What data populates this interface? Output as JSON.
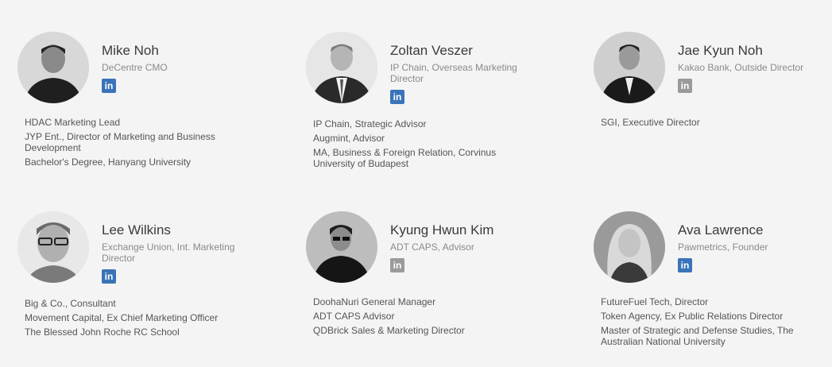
{
  "team": [
    {
      "name": "Mike Noh",
      "role": "DeCentre CMO",
      "linkedin_label": "in",
      "linkedin_active": true,
      "bio": [
        "HDAC Marketing Lead",
        "JYP Ent., Director of Marketing and Business Development",
        "Bachelor's Degree, Hanyang University"
      ]
    },
    {
      "name": "Zoltan Veszer",
      "role": "IP Chain, Overseas Marketing Director",
      "linkedin_label": "in",
      "linkedin_active": true,
      "bio": [
        "IP Chain, Strategic Advisor",
        "Augmint, Advisor",
        "MA, Business & Foreign Relation, Corvinus University of Budapest"
      ]
    },
    {
      "name": "Jae Kyun Noh",
      "role": "Kakao Bank, Outside Director",
      "linkedin_label": "in",
      "linkedin_active": false,
      "bio": [
        "SGI, Executive Director"
      ]
    },
    {
      "name": "Lee Wilkins",
      "role": "Exchange Union, Int. Marketing Director",
      "linkedin_label": "in",
      "linkedin_active": true,
      "bio": [
        "Big & Co., Consultant",
        "Movement Capital, Ex Chief Marketing Officer",
        "The Blessed John Roche RC School"
      ]
    },
    {
      "name": "Kyung Hwun Kim",
      "role": "ADT CAPS, Advisor",
      "linkedin_label": "in",
      "linkedin_active": false,
      "bio": [
        "DoohaNuri General Manager",
        "ADT CAPS Advisor",
        "QDBrick Sales & Marketing Director"
      ]
    },
    {
      "name": "Ava Lawrence",
      "role": "Pawmetrics, Founder",
      "linkedin_label": "in",
      "linkedin_active": true,
      "bio": [
        "FutureFuel Tech, Director",
        "Token Agency, Ex Public Relations Director",
        "Master of Strategic and Defense Studies, The Australian National University"
      ]
    }
  ],
  "colors": {
    "linkedin_blue": "#3a74b8",
    "linkedin_gray": "#9a9a9a",
    "background": "#f4f4f4"
  }
}
